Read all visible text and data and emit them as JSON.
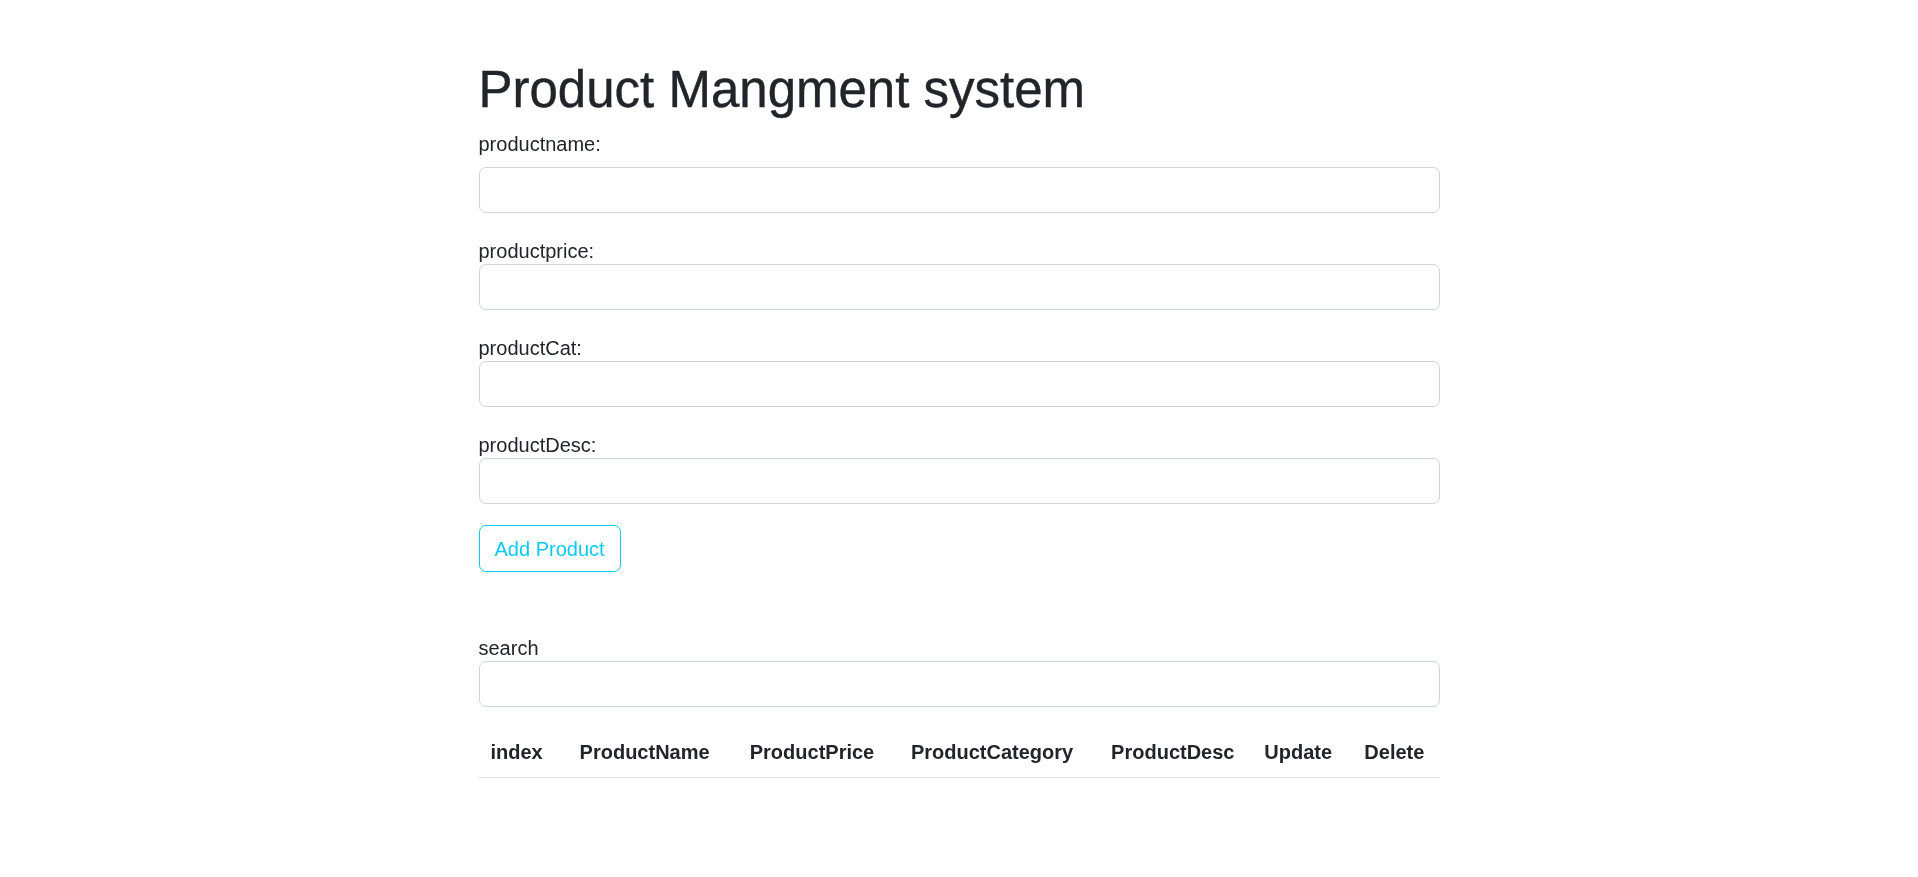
{
  "title": "Product Mangment system",
  "form": {
    "fields": [
      {
        "label": "productname:"
      },
      {
        "label": "productprice:"
      },
      {
        "label": "productCat:"
      },
      {
        "label": "productDesc:"
      }
    ],
    "submit_button": "Add Product"
  },
  "search": {
    "label": "search"
  },
  "table": {
    "columns": [
      "index",
      "ProductName",
      "ProductPrice",
      "ProductCategory",
      "ProductDesc",
      "Update",
      "Delete"
    ]
  }
}
